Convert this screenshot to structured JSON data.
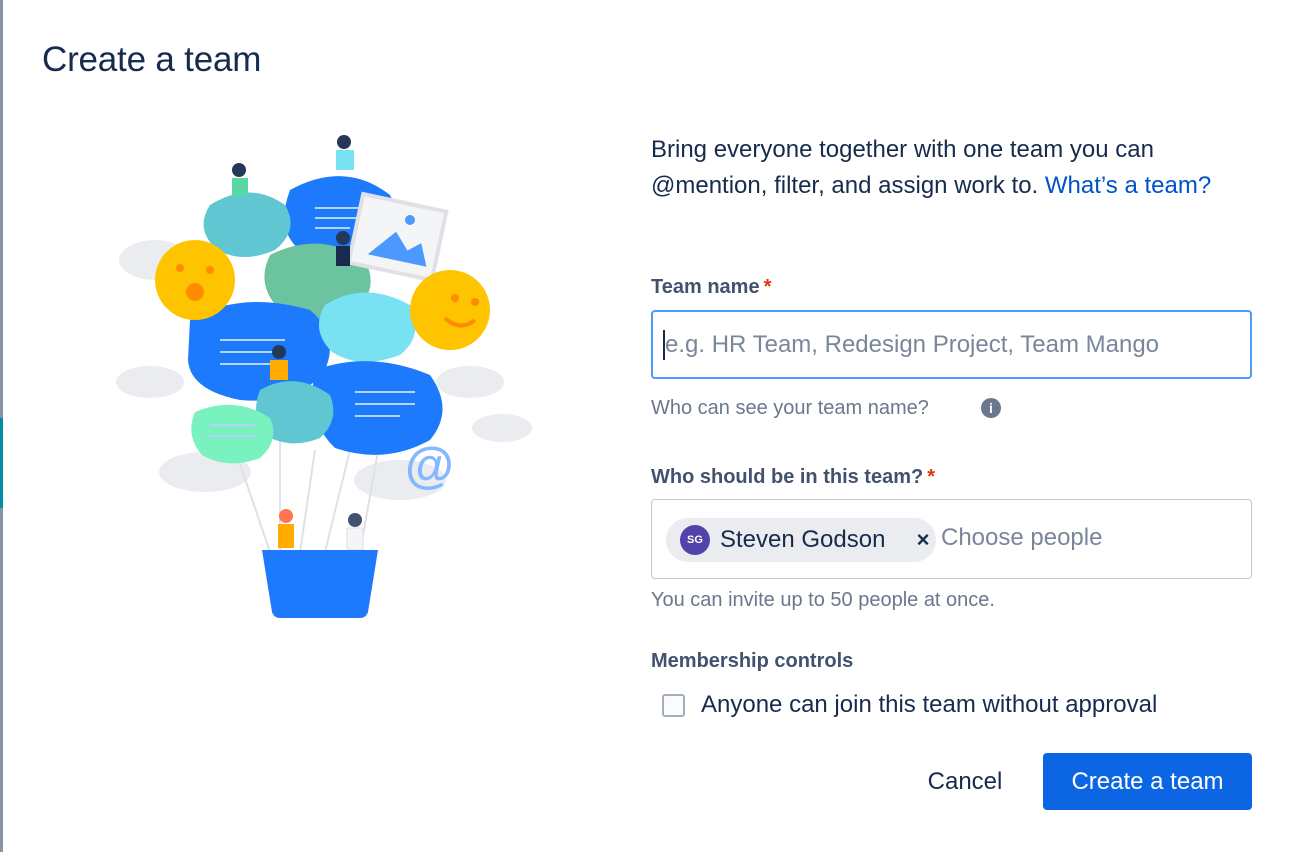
{
  "dialog": {
    "title": "Create a team",
    "intro_text": "Bring everyone together with one team you can @mention, filter, and assign work to. ",
    "intro_link": "What’s a team?"
  },
  "team_name": {
    "label": "Team name",
    "required_marker": "*",
    "value": "",
    "placeholder": "e.g. HR Team, Redesign Project, Team Mango",
    "helper": "Who can see your team name?",
    "info_glyph": "i"
  },
  "members": {
    "label": "Who should be in this team?",
    "required_marker": "*",
    "selected": [
      {
        "initials": "SG",
        "name": "Steven Godson",
        "remove_glyph": "×"
      }
    ],
    "placeholder": "Choose people",
    "helper": "You can invite up to 50 people at once."
  },
  "membership_controls": {
    "label": "Membership controls",
    "option_label": "Anyone can join this team without approval",
    "checked": false
  },
  "actions": {
    "cancel_label": "Cancel",
    "create_label": "Create a team"
  },
  "colors": {
    "primary": "#0c66e4",
    "link": "#0052cc",
    "focus_border": "#4c9aff",
    "required": "#de350b",
    "avatar": "#5243aa"
  },
  "icons": {
    "info": "info-icon",
    "remove": "close-icon",
    "illustration": "team-balloon-illustration"
  }
}
